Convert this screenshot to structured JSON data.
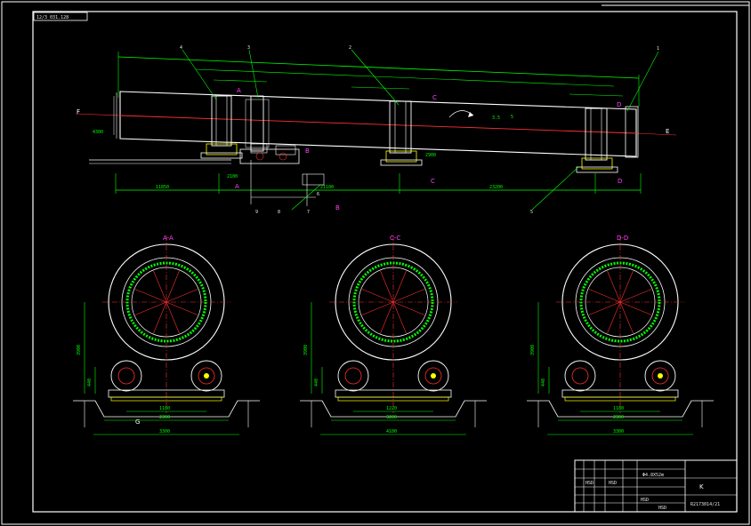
{
  "drawing": {
    "header_tag": "12/3 031.128",
    "elevation_view": {
      "part_numbers": [
        "1",
        "2",
        "3",
        "4",
        "5",
        "6",
        "7",
        "8",
        "9"
      ],
      "section_marks": [
        "A",
        "A",
        "B",
        "B",
        "C",
        "C",
        "D",
        "D",
        "E",
        "F"
      ],
      "dimensions": {
        "d_11850": "11850",
        "d_21100": "21100",
        "d_23200": "23200",
        "d_2100": "2100",
        "d_2900": "2900",
        "d_4300": "4300",
        "d_35": "3.5",
        "d_5": "5"
      }
    },
    "section_views": [
      {
        "id": "view-a",
        "title": "A-A",
        "dims": {
          "base": "2300",
          "overall": "3300",
          "center": "1180",
          "height": "3900",
          "low": "440"
        },
        "marker": "G"
      },
      {
        "id": "view-c",
        "title": "C-C",
        "dims": {
          "base": "3200",
          "overall": "4100",
          "center": "1220",
          "height": "3900",
          "low": "440"
        },
        "marker": ""
      },
      {
        "id": "view-d",
        "title": "D-D",
        "dims": {
          "base": "2300",
          "overall": "3300",
          "center": "1180",
          "height": "3900",
          "low": "440"
        },
        "marker": ""
      }
    ],
    "title_block": {
      "company": "",
      "project": "Φ4.8X52m",
      "drawing_number": "R2173014/21",
      "row_texts": [
        "HSD",
        "HSD",
        "HSD",
        "K",
        "HSD"
      ]
    }
  }
}
